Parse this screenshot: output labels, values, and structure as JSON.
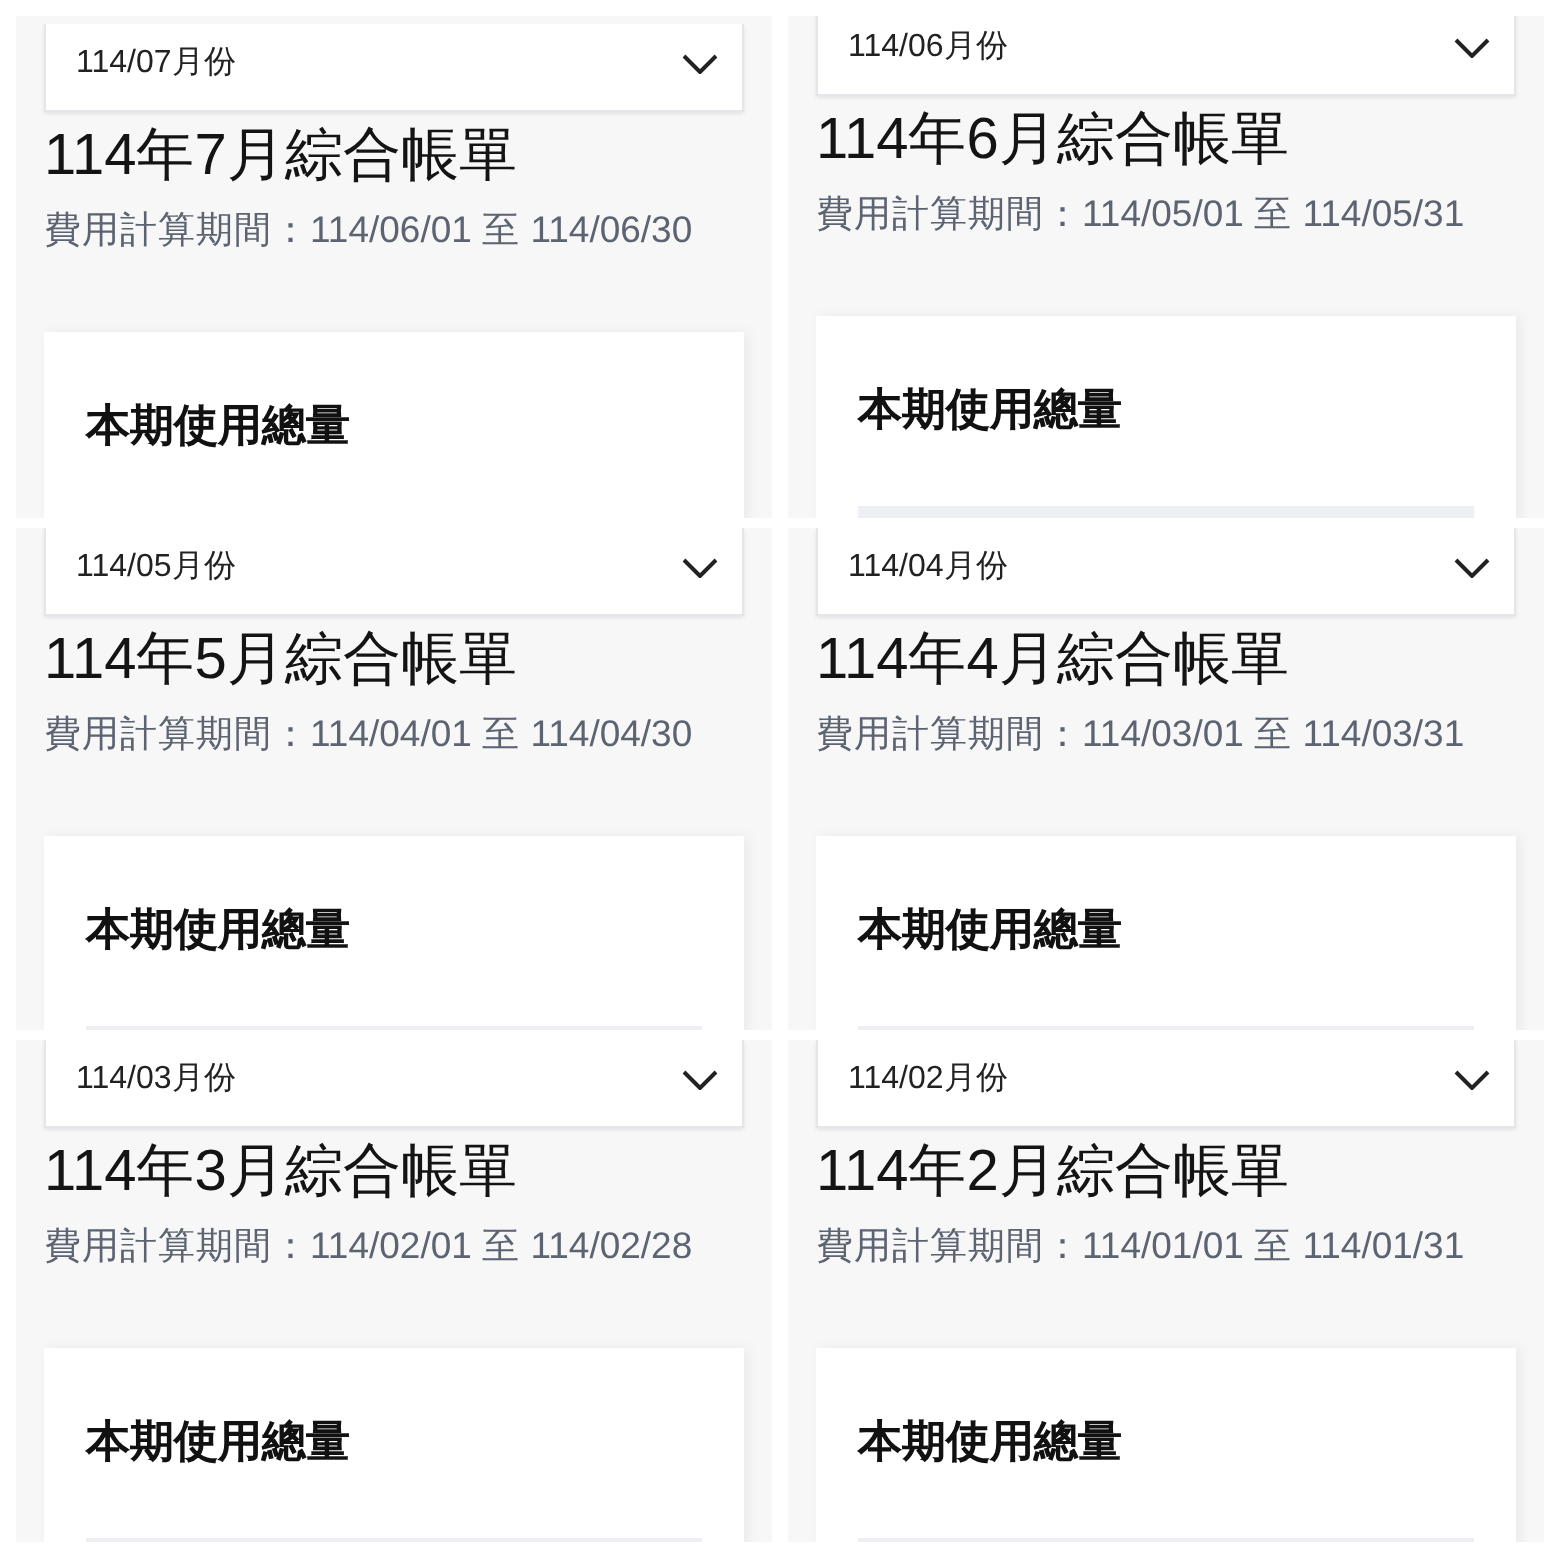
{
  "panels": [
    {
      "month_select": {
        "value": "114/07月份"
      },
      "title": "114年7月綜合帳單",
      "period": "費用計算期間：114/06/01 至 114/06/30",
      "usage_card": {
        "heading": "本期使用總量"
      }
    },
    {
      "month_select": {
        "value": "114/06月份"
      },
      "title": "114年6月綜合帳單",
      "period": "費用計算期間：114/05/01 至 114/05/31",
      "usage_card": {
        "heading": "本期使用總量"
      }
    },
    {
      "month_select": {
        "value": "114/05月份"
      },
      "title": "114年5月綜合帳單",
      "period": "費用計算期間：114/04/01 至 114/04/30",
      "usage_card": {
        "heading": "本期使用總量"
      }
    },
    {
      "month_select": {
        "value": "114/04月份"
      },
      "title": "114年4月綜合帳單",
      "period": "費用計算期間：114/03/01 至 114/03/31",
      "usage_card": {
        "heading": "本期使用總量"
      }
    },
    {
      "month_select": {
        "value": "114/03月份"
      },
      "title": "114年3月綜合帳單",
      "period": "費用計算期間：114/02/01 至 114/02/28",
      "usage_card": {
        "heading": "本期使用總量"
      }
    },
    {
      "month_select": {
        "value": "114/02月份"
      },
      "title": "114年2月綜合帳單",
      "period": "費用計算期間：114/01/01 至 114/01/31",
      "usage_card": {
        "heading": "本期使用總量"
      }
    }
  ]
}
